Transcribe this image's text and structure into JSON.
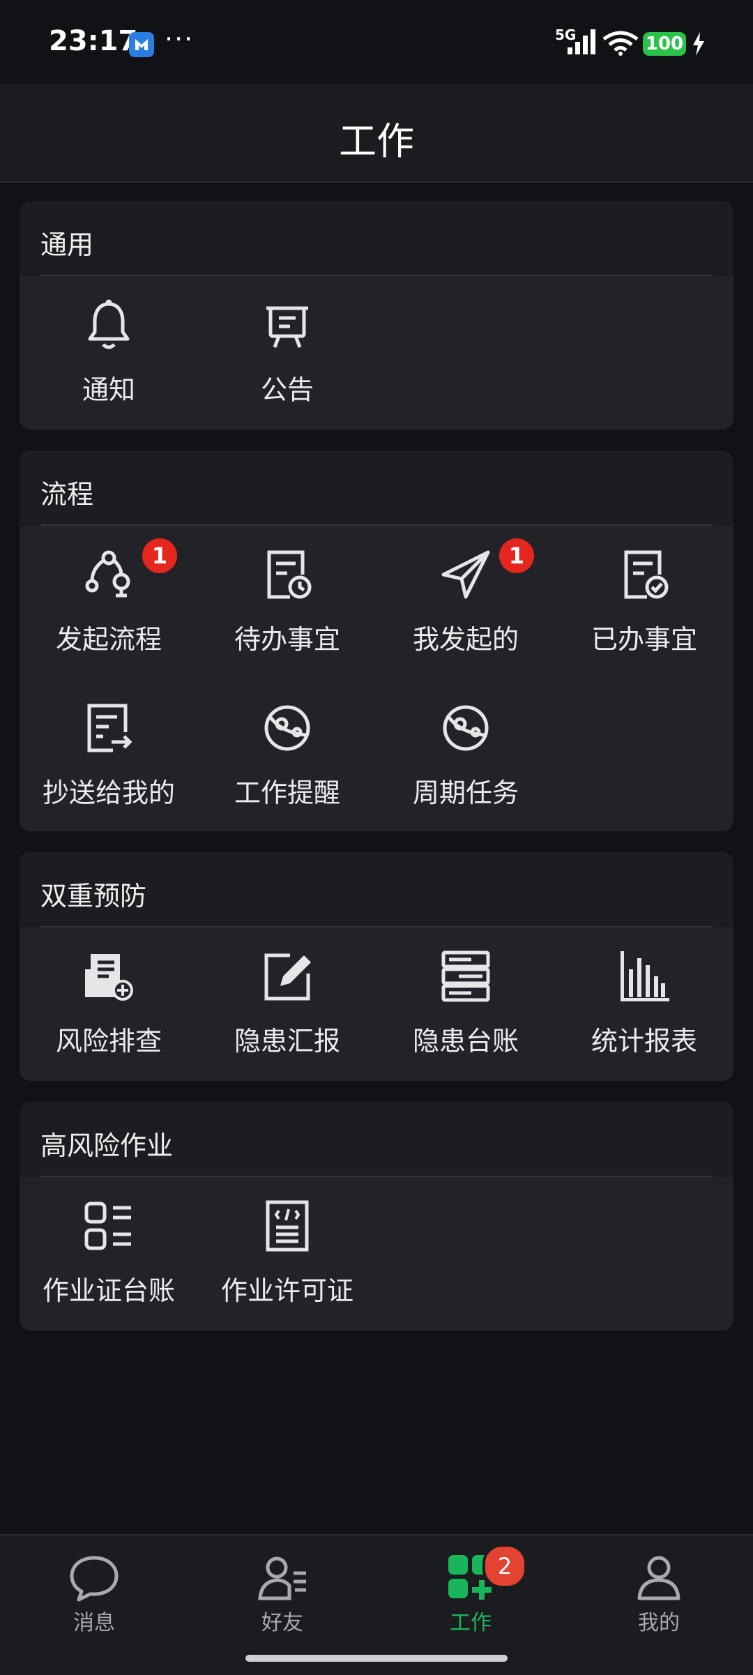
{
  "status_bar": {
    "time": "23:17",
    "network": "5G",
    "battery": "100"
  },
  "header": {
    "title": "工作"
  },
  "sections": [
    {
      "title": "通用",
      "items": [
        {
          "label": "通知",
          "icon": "bell-icon"
        },
        {
          "label": "公告",
          "icon": "announcement-board-icon"
        }
      ]
    },
    {
      "title": "流程",
      "items": [
        {
          "label": "发起流程",
          "icon": "flow-start-icon",
          "badge": "1"
        },
        {
          "label": "待办事宜",
          "icon": "pending-doc-clock-icon"
        },
        {
          "label": "我发起的",
          "icon": "paper-plane-icon",
          "badge": "1"
        },
        {
          "label": "已办事宜",
          "icon": "done-doc-check-icon"
        },
        {
          "label": "抄送给我的",
          "icon": "doc-forward-icon"
        },
        {
          "label": "工作提醒",
          "icon": "orbit-icon"
        },
        {
          "label": "周期任务",
          "icon": "orbit-icon"
        }
      ]
    },
    {
      "title": "双重预防",
      "items": [
        {
          "label": "风险排查",
          "icon": "report-add-icon"
        },
        {
          "label": "隐患汇报",
          "icon": "edit-square-icon"
        },
        {
          "label": "隐患台账",
          "icon": "server-stack-icon"
        },
        {
          "label": "统计报表",
          "icon": "bar-chart-icon"
        }
      ]
    },
    {
      "title": "高风险作业",
      "items": [
        {
          "label": "作业证台账",
          "icon": "list-icon"
        },
        {
          "label": "作业许可证",
          "icon": "code-doc-icon"
        }
      ]
    }
  ],
  "bottom_nav": {
    "tabs": [
      {
        "label": "消息",
        "icon": "chat-bubble-icon"
      },
      {
        "label": "好友",
        "icon": "contacts-icon"
      },
      {
        "label": "工作",
        "icon": "apps-grid-icon",
        "badge": "2",
        "active": true
      },
      {
        "label": "我的",
        "icon": "person-icon"
      }
    ]
  },
  "colors": {
    "accent": "#19b55a",
    "badge": "#e5261e",
    "background": "#111216",
    "card": "#222328"
  }
}
